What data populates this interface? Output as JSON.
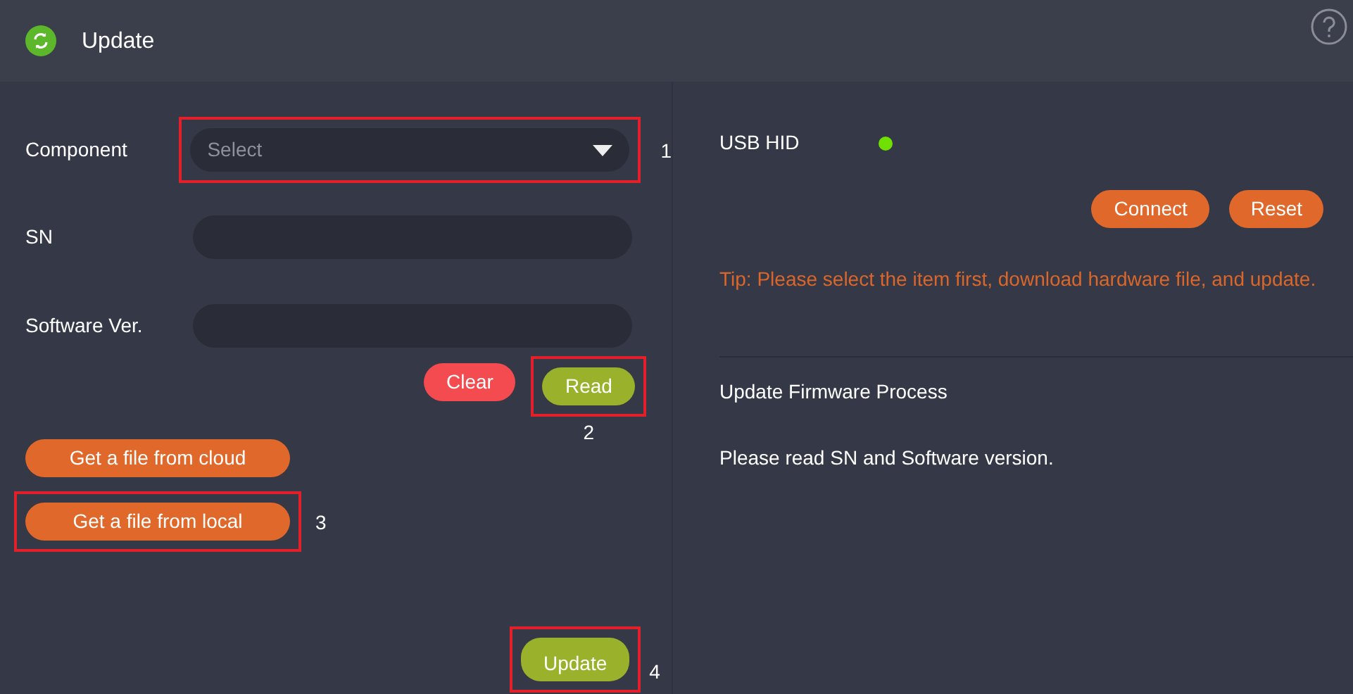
{
  "header": {
    "title": "Update"
  },
  "form": {
    "fields": [
      {
        "label": "Component",
        "kind": "select",
        "placeholder": "Select",
        "callout": "1"
      },
      {
        "label": "SN",
        "kind": "text"
      },
      {
        "label": "Software Ver.",
        "kind": "text"
      }
    ],
    "read_buttons": [
      {
        "label": "Clear",
        "kind": "danger"
      },
      {
        "label": "Read",
        "kind": "success",
        "callout": "2"
      }
    ],
    "file_buttons": [
      {
        "label": "Get a file from cloud"
      },
      {
        "label": "Get a file from local",
        "callout": "3"
      }
    ],
    "update_button": {
      "label": "Update",
      "callout": "4"
    }
  },
  "device": {
    "label": "USB HID",
    "connected": true,
    "buttons": [
      {
        "label": "Connect"
      },
      {
        "label": "Reset"
      }
    ],
    "tip": "Tip: Please select the item first, download hardware file, and update."
  },
  "process": {
    "title": "Update Firmware Process",
    "message": "Please read SN and Software version."
  }
}
